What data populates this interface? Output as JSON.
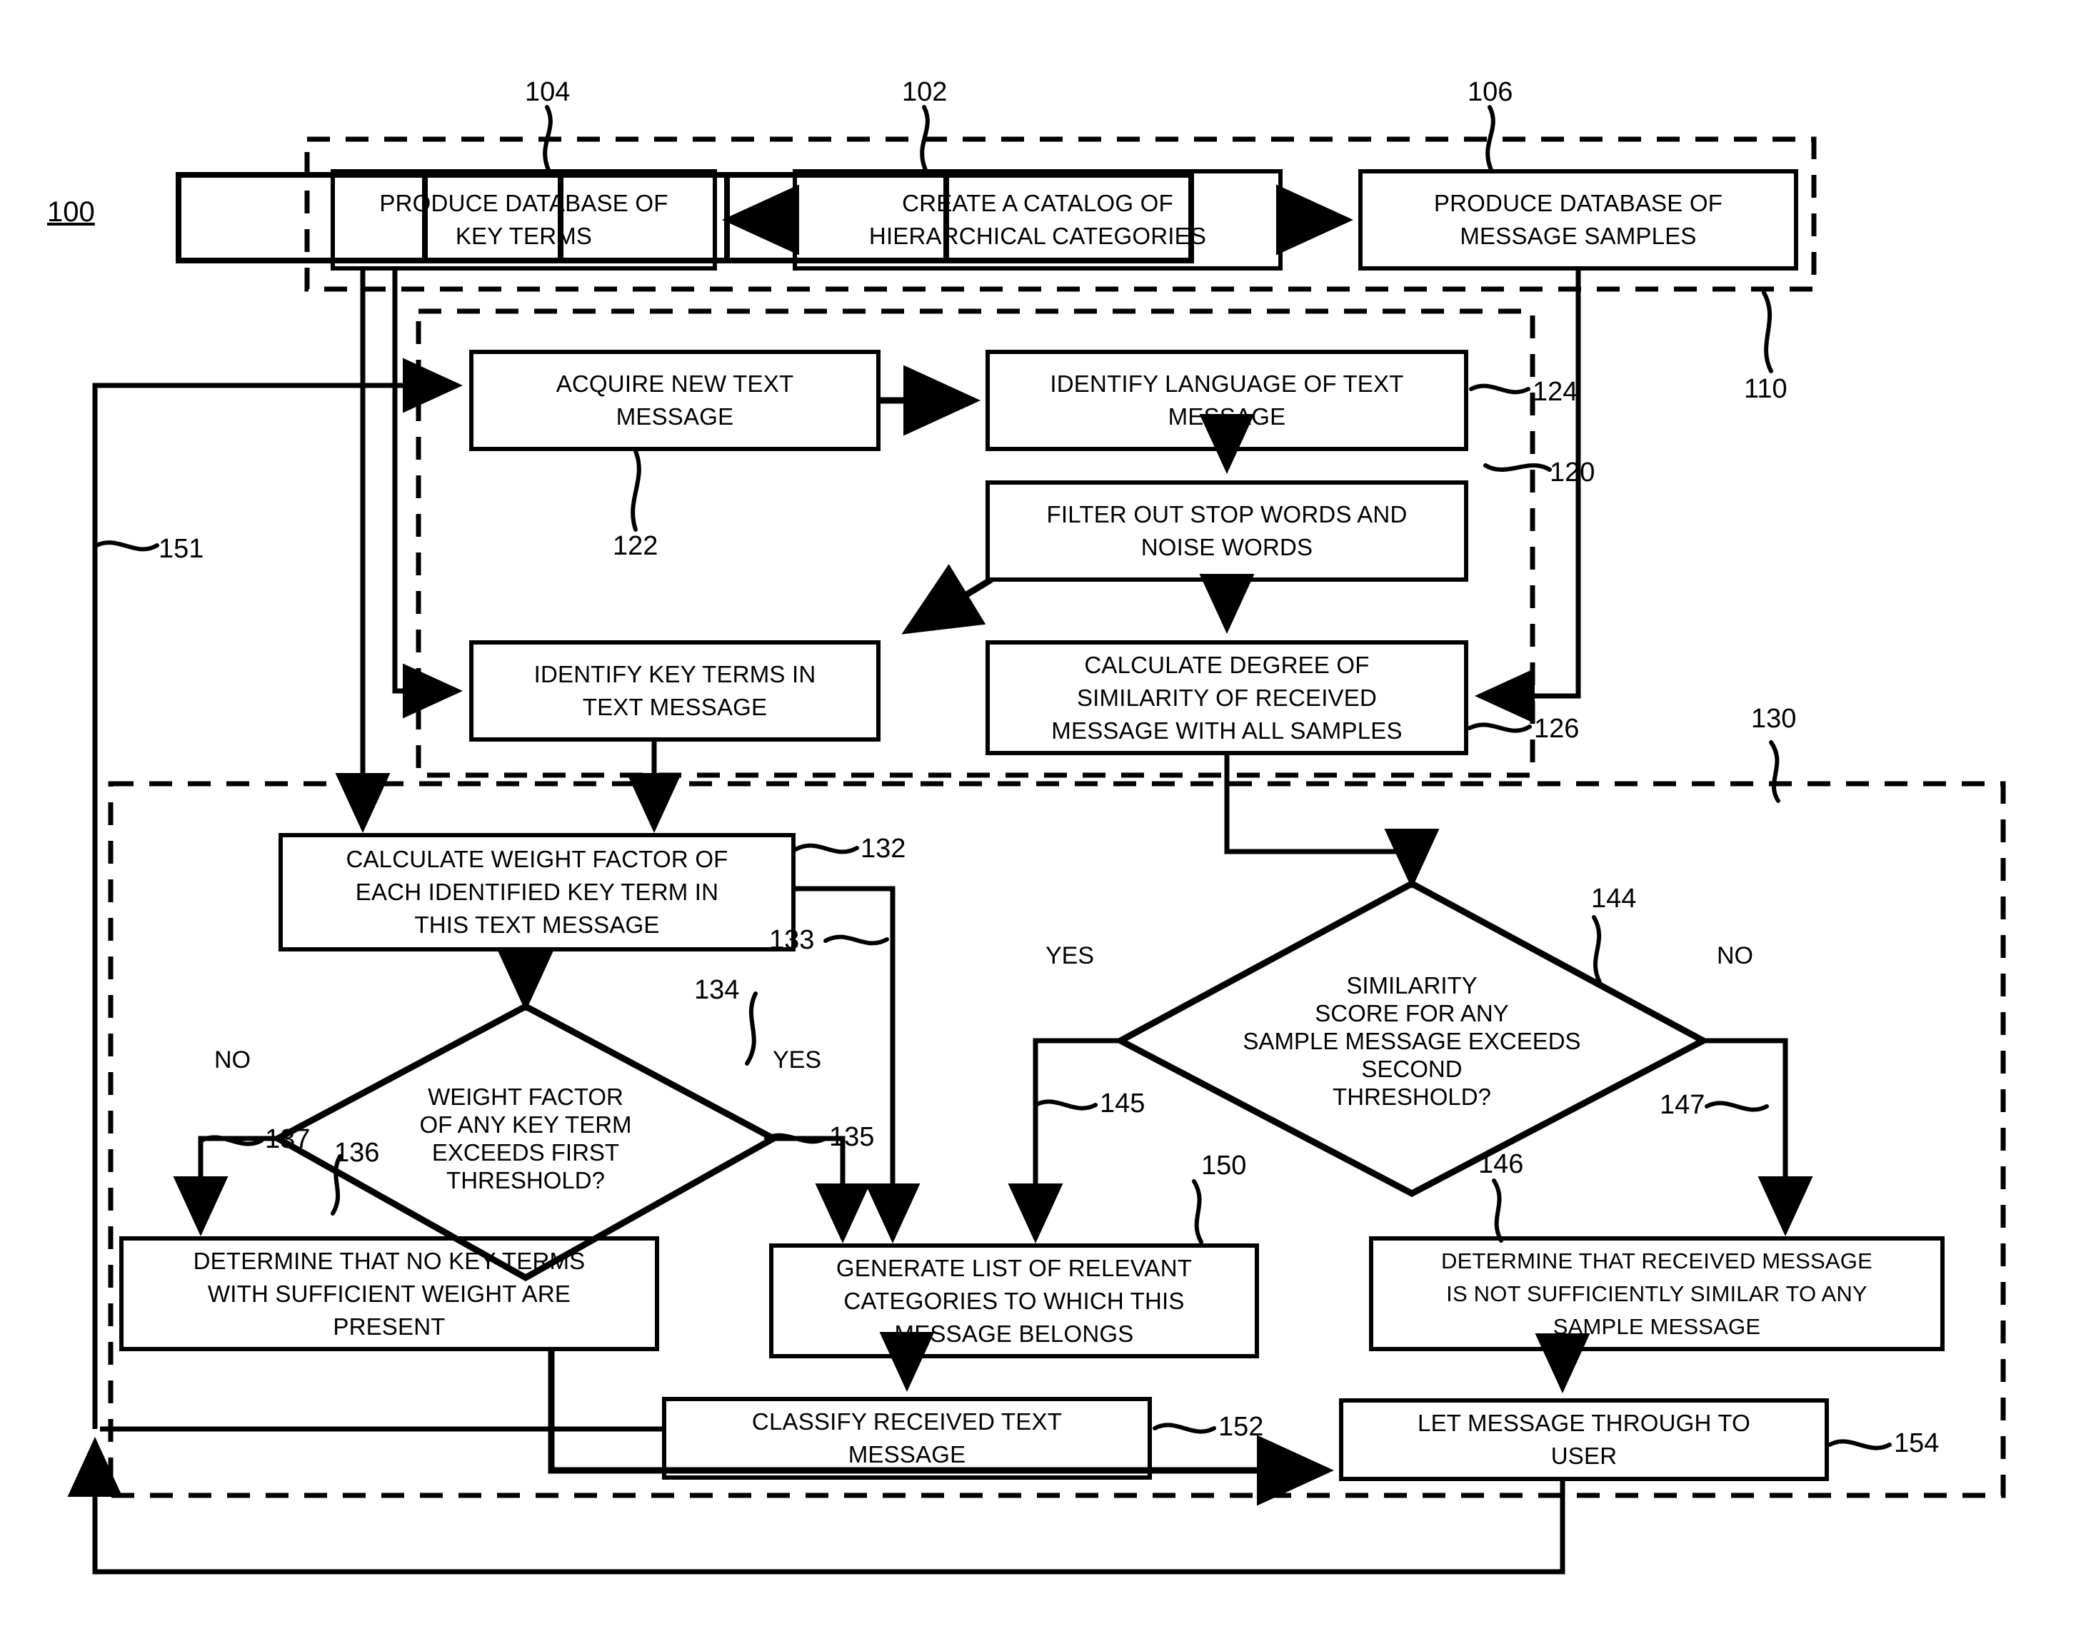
{
  "figure": {
    "tag": "100"
  },
  "groups": [
    {
      "id": "g110",
      "ref": "110",
      "name": "setup-group"
    },
    {
      "id": "g120",
      "ref": "120",
      "name": "preprocess-group"
    },
    {
      "id": "g130",
      "ref": "130",
      "name": "classify-group"
    }
  ],
  "boxes": [
    {
      "id": "b104",
      "ref": "104",
      "text": "PRODUCE DATABASE OF\nKEY TERMS"
    },
    {
      "id": "b102",
      "ref": "102",
      "text": "CREATE A CATALOG OF\nHIERARCHICAL CATEGORIES"
    },
    {
      "id": "b106",
      "ref": "106",
      "text": "PRODUCE DATABASE OF\nMESSAGE SAMPLES"
    },
    {
      "id": "b122",
      "ref": "122",
      "text": "ACQUIRE NEW TEXT\nMESSAGE"
    },
    {
      "id": "b124",
      "ref": "124",
      "text": "IDENTIFY LANGUAGE OF TEXT\nMESSAGE"
    },
    {
      "id": "b125",
      "ref": "",
      "text": "FILTER OUT STOP WORDS AND\nNOISE WORDS"
    },
    {
      "id": "b123",
      "ref": "",
      "text": "IDENTIFY KEY TERMS IN\nTEXT MESSAGE"
    },
    {
      "id": "b126",
      "ref": "126",
      "text": "CALCULATE DEGREE OF\nSIMILARITY OF RECEIVED\nMESSAGE WITH ALL SAMPLES"
    },
    {
      "id": "b132",
      "ref": "132",
      "text": "CALCULATE WEIGHT FACTOR OF\nEACH IDENTIFIED KEY TERM IN\nTHIS TEXT MESSAGE"
    },
    {
      "id": "b136",
      "ref": "136",
      "text": "DETERMINE THAT NO KEY TERMS\nWITH SUFFICIENT WEIGHT ARE\nPRESENT"
    },
    {
      "id": "b150",
      "ref": "150",
      "text": "GENERATE LIST OF RELEVANT\nCATEGORIES TO WHICH THIS\nMESSAGE BELONGS"
    },
    {
      "id": "b146",
      "ref": "146",
      "text": "DETERMINE THAT RECEIVED MESSAGE\nIS NOT SUFFICIENTLY SIMILAR TO ANY\nSAMPLE MESSAGE"
    },
    {
      "id": "b152",
      "ref": "152",
      "text": "CLASSIFY RECEIVED TEXT\nMESSAGE"
    },
    {
      "id": "b154",
      "ref": "154",
      "text": "LET MESSAGE THROUGH TO\nUSER"
    }
  ],
  "diamonds": [
    {
      "id": "d134",
      "ref": "134",
      "text": "WEIGHT FACTOR\nOF ANY KEY TERM\nEXCEEDS FIRST\nTHRESHOLD?",
      "no_label": "NO",
      "yes_label": "YES",
      "no_ref": "137",
      "yes_ref": "135"
    },
    {
      "id": "d144",
      "ref": "144",
      "text": "SIMILARITY\nSCORE FOR ANY\nSAMPLE MESSAGE EXCEEDS\nSECOND\nTHRESHOLD?",
      "yes_label": "YES",
      "no_label": "NO",
      "yes_ref": "145",
      "no_ref": "147"
    }
  ],
  "edge_refs": [
    {
      "id": "e151",
      "ref": "151"
    },
    {
      "id": "e133",
      "ref": "133"
    }
  ]
}
